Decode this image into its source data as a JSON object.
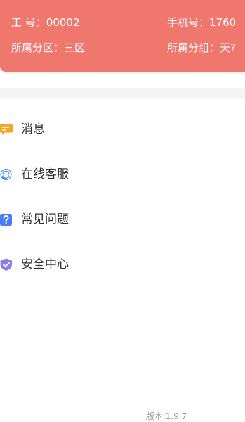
{
  "header": {
    "employee_no_label": "工 号：",
    "employee_no_value": "00002",
    "phone_label": "手机号：",
    "phone_value": "1760",
    "district_label": "所属分区：",
    "district_value": "三区",
    "group_label": "所属分组：",
    "group_value": "天?"
  },
  "menu": {
    "messages": {
      "label": "消息",
      "icon": "message-icon",
      "color": "#f5a623"
    },
    "customer_service": {
      "label": "在线客服",
      "icon": "customer-service-icon",
      "color": "#3d8bf7"
    },
    "faq": {
      "label": "常见问题",
      "icon": "question-icon",
      "color": "#4c7df5"
    },
    "security": {
      "label": "安全中心",
      "icon": "shield-check-icon",
      "color": "#8b7cf0"
    }
  },
  "footer": {
    "version": "版本:1.9.7"
  },
  "colors": {
    "header_bg": "#ef776d",
    "separator": "#f4f4f4",
    "text": "#333333",
    "muted": "#9a9a9a"
  }
}
